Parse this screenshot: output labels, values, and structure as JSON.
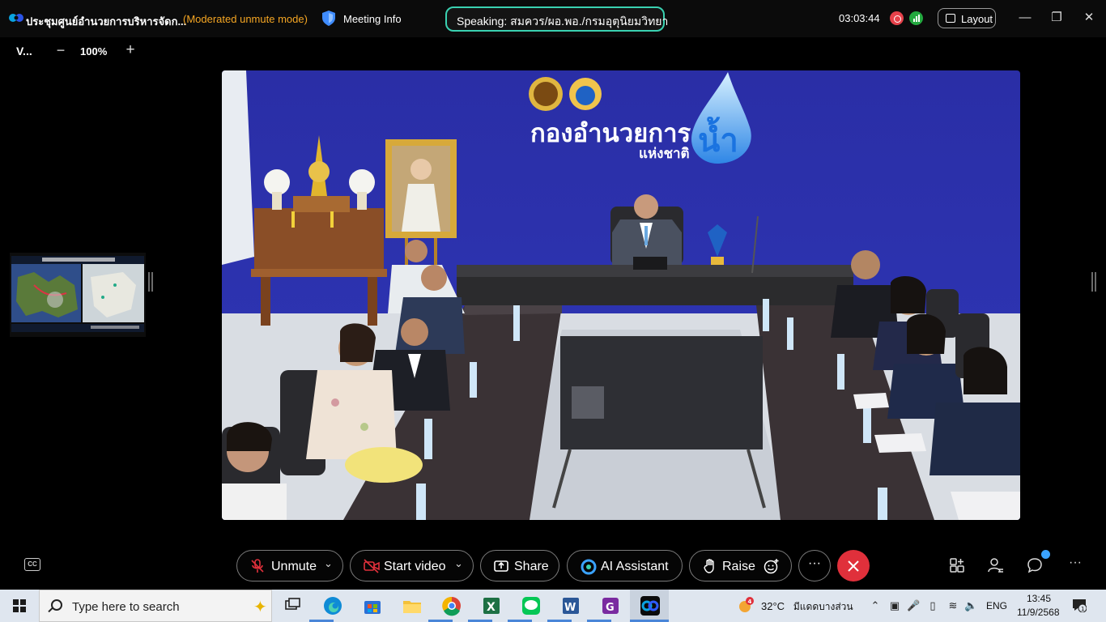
{
  "titlebar": {
    "meeting_title": "ประชุมศูนย์อำนวยการบริหารจัดก...",
    "mode": "(Moderated unmute mode)",
    "meeting_info": "Meeting Info",
    "speaking": "Speaking: สมควร/ผอ.พอ./กรมอุตุนิยมวิทยา",
    "elapsed": "03:03:44",
    "layout_label": "Layout"
  },
  "view": {
    "label": "V...",
    "zoom": "100%"
  },
  "video": {
    "banner_line1": "กองอำนวยการ",
    "banner_line2": "แห่งชาติ",
    "banner_drop": "น้ำ"
  },
  "toolbar": {
    "unmute": "Unmute",
    "start_video": "Start video",
    "share": "Share",
    "ai_assistant": "AI Assistant",
    "raise": "Raise",
    "more": "···"
  },
  "taskbar": {
    "search_placeholder": "Type here to search",
    "weather_temp": "32°C",
    "weather_desc": "มีแดดบางส่วน",
    "weather_badge": "4",
    "lang": "ENG",
    "time": "13:45",
    "date": "11/9/2568",
    "notifications": "1"
  },
  "colors": {
    "accent_teal": "#3ad1b1",
    "mode_orange": "#f5a623",
    "end_red": "#e0303b",
    "record_red": "#e5414a",
    "signal_green": "#23a83f",
    "banner_blue": "#2b2fa8"
  },
  "icons": {
    "app_logo": "webex-logo-icon",
    "shield": "shield-icon",
    "mic": "mic-muted-icon",
    "video": "video-off-icon",
    "share": "share-icon",
    "ai": "ai-assistant-icon",
    "raise": "hand-icon",
    "reactions": "reaction-icon",
    "end": "close-icon",
    "apps": "apps-icon",
    "participants": "participants-icon",
    "chat": "chat-icon"
  }
}
